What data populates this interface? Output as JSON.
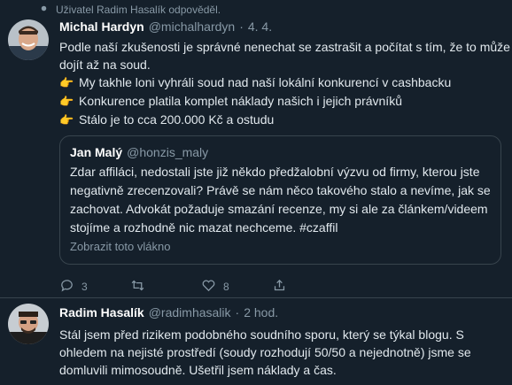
{
  "retweet": {
    "text": "Uživatel Radim Hasalík odpověděl."
  },
  "tweet1": {
    "name": "Michal Hardyn",
    "handle": "@michalhardyn",
    "dot": "·",
    "time": "4. 4.",
    "line1": "Podle naší zkušenosti je správné nenechat se zastrašit a počítat s tím, že to může",
    "line2": "dojít až na soud.",
    "bullets": [
      "My takhle loni vyhráli soud nad naší lokální konkurencí v cashbacku",
      "Konkurence platila komplet náklady našich i jejich právníků",
      "Stálo je to cca 200.000 Kč a ostudu"
    ],
    "bullet_icon": "👉",
    "quote": {
      "name": "Jan Malý",
      "handle": "@honzis_maly",
      "text": "Zdar affiláci, nedostali jste již někdo předžalobní výzvu od firmy, kterou jste negativně zrecenzovali? Právě se nám něco takového stalo a nevíme, jak se zachovat. Advokát požaduje smazání recenze, my si ale za článkem/videem stojíme a rozhodně nic mazat nechceme. #czaffil",
      "thread_link": "Zobrazit toto vlákno"
    },
    "actions": {
      "reply_count": "3",
      "retweet_count": "",
      "like_count": "8"
    }
  },
  "tweet2": {
    "name": "Radim Hasalík",
    "handle": "@radimhasalik",
    "dot": "·",
    "time": "2 hod.",
    "text": "Stál jsem před rizikem podobného soudního sporu, který se týkal blogu. S ohledem na nejisté prostředí (soudy rozhodují 50/50 a nejednotně) jsme se domluvili mimosoudně. Ušetřil jsem náklady a čas."
  },
  "colors": {
    "background": "#15202b",
    "secondary_text": "#8899a6",
    "border": "#38444d"
  }
}
